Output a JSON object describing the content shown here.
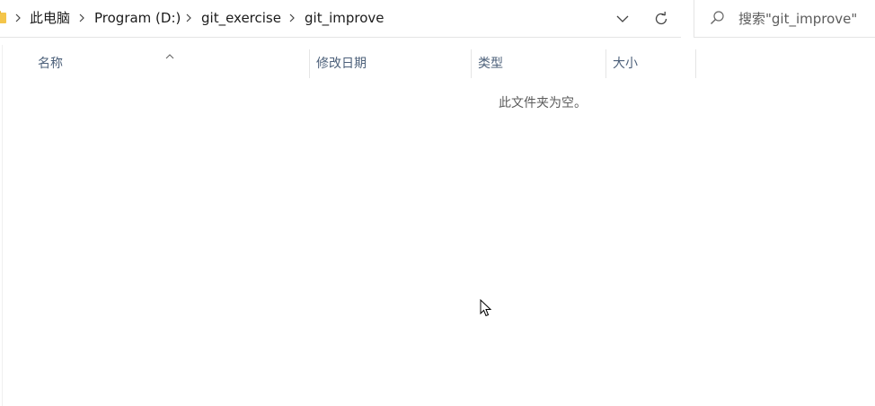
{
  "address_bar": {
    "breadcrumbs": [
      "此电脑",
      "Program (D:)",
      "git_exercise",
      "git_improve"
    ],
    "icons": {
      "folder": "folder-icon",
      "separator": "chevron-right-icon",
      "history": "chevron-down-icon",
      "refresh": "refresh-icon"
    }
  },
  "search": {
    "placeholder": "搜索\"git_improve\"",
    "icon": "search-icon"
  },
  "columns": {
    "name": "名称",
    "modified": "修改日期",
    "type": "类型",
    "size": "大小"
  },
  "sort_indicator": "sort-ascending-icon",
  "content": {
    "empty_message": "此文件夹为空。"
  },
  "colors": {
    "folder": "#f4c54a",
    "header_text": "#4c607a",
    "divider": "#e5e5e5"
  }
}
